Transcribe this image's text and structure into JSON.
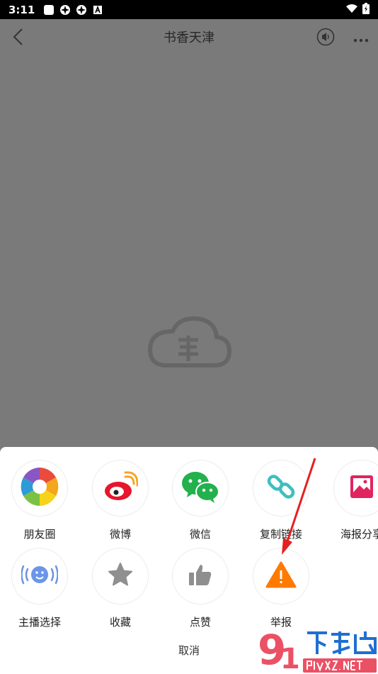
{
  "status": {
    "time": "3:11"
  },
  "header": {
    "title": "书香天津"
  },
  "share_row1": [
    {
      "label": "朋友圈"
    },
    {
      "label": "微博"
    },
    {
      "label": "微信"
    },
    {
      "label": "复制链接"
    },
    {
      "label": "海报分享"
    }
  ],
  "share_row2": [
    {
      "label": "主播选择"
    },
    {
      "label": "收藏"
    },
    {
      "label": "点赞"
    },
    {
      "label": "举报"
    }
  ],
  "cancel_label": "取消",
  "colors": {
    "report": "#ff7a00",
    "wechat": "#22b14c",
    "weibo": "#e6162d",
    "poster": "#e0245e"
  }
}
